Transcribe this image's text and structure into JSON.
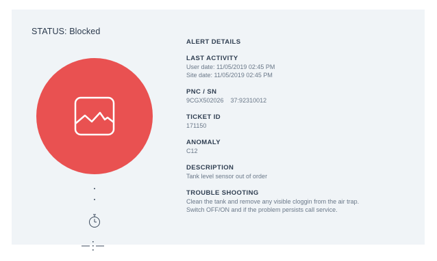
{
  "status": {
    "label": "STATUS:",
    "value": "Blocked"
  },
  "details": {
    "heading": "ALERT DETAILS",
    "last_activity": {
      "label": "LAST ACTIVITY",
      "user_date": "User date: 11/05/2019 02:45 PM",
      "site_date": "Site date: 11/05/2019 02:45 PM"
    },
    "pnc_sn": {
      "label": "PNC / SN",
      "pnc": "9CGX502026",
      "sn": "37:92310012"
    },
    "ticket": {
      "label": "TICKET ID",
      "value": "171150"
    },
    "anomaly": {
      "label": "ANOMALY",
      "value": "C12"
    },
    "description": {
      "label": "DESCRIPTION",
      "value": "Tank level sensor out of order"
    },
    "trouble": {
      "label": "TROUBLE SHOOTING",
      "line1": "Clean the tank and remove any visible cloggin from the air trap.",
      "line2": "Switch OFF/ON and if the problem persists call service."
    }
  },
  "colors": {
    "alert": "#e95151",
    "panel": "#f0f4f7",
    "text": "#2f3e51"
  },
  "icons": {
    "alert": "line-chart-icon",
    "timer": "stopwatch-icon",
    "divider": "dotted-line-icon"
  }
}
